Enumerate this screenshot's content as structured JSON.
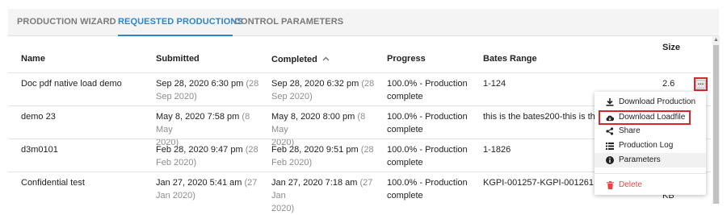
{
  "tabs": [
    {
      "label": "PRODUCTION WIZARD",
      "active": false
    },
    {
      "label": "REQUESTED PRODUCTIONS",
      "active": true
    },
    {
      "label": "CONTROL PARAMETERS",
      "active": false
    }
  ],
  "table": {
    "columns": {
      "name": "Name",
      "submitted": "Submitted",
      "completed": "Completed",
      "completed_sort_icon": "chevron-up-icon",
      "progress": "Progress",
      "bates": "Bates Range",
      "size": "Size"
    },
    "rows": [
      {
        "name": "Doc pdf native load demo",
        "submitted": "Sep 28, 2020 6:30 pm",
        "submitted_rel_a": "(28",
        "submitted_rel_b": "Sep 2020)",
        "completed": "Sep 28, 2020 6:32 pm",
        "completed_rel_a": "(28",
        "completed_rel_b": "Sep 2020)",
        "progress_a": "100.0% - Production",
        "progress_b": "complete",
        "bates": "1-124",
        "size": "2.6"
      },
      {
        "name": "demo 23",
        "submitted": "May 8, 2020 7:58 pm",
        "submitted_rel_a": "(8 May",
        "submitted_rel_b": "2020)",
        "completed": "May 8, 2020 8:00 pm",
        "completed_rel_a": "(8 May",
        "completed_rel_b": "2020)",
        "progress_a": "100.0% - Production",
        "progress_b": "complete",
        "bates": "this is the bates200-this is the",
        "size": ""
      },
      {
        "name": "d3m0101",
        "submitted": "Feb 28, 2020 9:47 pm",
        "submitted_rel_a": "(28",
        "submitted_rel_b": "Feb 2020)",
        "completed": "Feb 28, 2020 9:51 pm",
        "completed_rel_a": "(28",
        "completed_rel_b": "Feb 2020)",
        "progress_a": "100.0% - Production",
        "progress_b": "complete",
        "bates": "1-1826",
        "size": ""
      },
      {
        "name": "Confidential test",
        "submitted": "Jan 27, 2020 5:41 am",
        "submitted_rel_a": "(27",
        "submitted_rel_b": "Jan 2020)",
        "completed": "Jan 27, 2020 7:18 am",
        "completed_rel_a": "(27 Jan",
        "completed_rel_b": "2020)",
        "progress_a": "100.0% - Production",
        "progress_b": "complete",
        "bates": "KGPI-001257-KGPI-001261",
        "size": "KB"
      }
    ]
  },
  "menu": {
    "trigger_label": "...",
    "items": [
      {
        "label": "Download Production",
        "icon": "download-icon"
      },
      {
        "label": "Download Loadfile",
        "icon": "cloud-download-icon"
      },
      {
        "label": "Share",
        "icon": "share-icon"
      },
      {
        "label": "Production Log",
        "icon": "list-icon"
      },
      {
        "label": "Parameters",
        "icon": "info-icon"
      },
      {
        "label": "Delete",
        "icon": "trash-icon"
      }
    ]
  },
  "colors": {
    "accent": "#2e86c8",
    "highlight_border": "#d9262c",
    "delete": "#e04848",
    "muted_text": "#8d8d8d"
  }
}
